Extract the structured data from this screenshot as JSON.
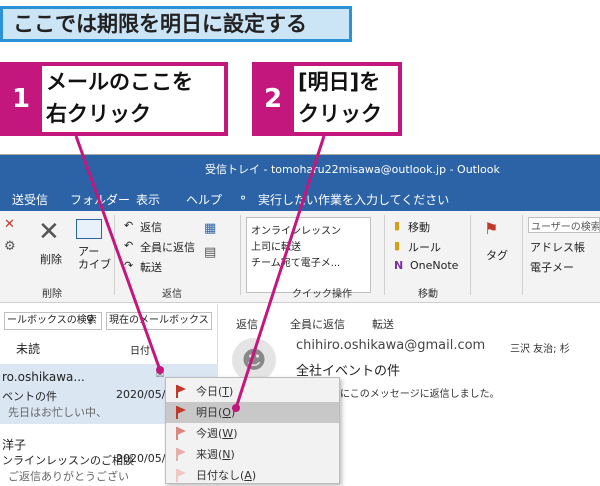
{
  "headline": "ここでは期限を明日に設定する",
  "steps": [
    {
      "num": "1",
      "line1": "メールのここを",
      "line2": "右クリック"
    },
    {
      "num": "2",
      "line1": "[明日]を",
      "line2": "クリック"
    }
  ],
  "colors": {
    "accent": "#c4177d",
    "headline_bg": "#cce5f6",
    "headline_border": "#2a93d8",
    "titlebar": "#2b63a6",
    "flag": "#c0392b"
  },
  "window": {
    "title": "受信トレイ - tomoharu22misawa@outlook.jp  -  Outlook",
    "menu": [
      "送受信",
      "フォルダー",
      "表示",
      "ヘルプ"
    ],
    "tell_me": "実行したい作業を入力してください",
    "tell_me_icon": "lightbulb-icon"
  },
  "ribbon": {
    "delete": {
      "label": "削除",
      "archive": "アー\nカイブ",
      "group": "削除"
    },
    "respond": {
      "reply": "返信",
      "reply_all": "全員に返信",
      "forward": "転送",
      "group": "返信"
    },
    "quick_steps": {
      "items": [
        "オンラインレッスン",
        "上司に転送",
        "チーム宛て電子メ..."
      ],
      "group": "クイック操作"
    },
    "move": {
      "move": "移動",
      "rules": "ルール",
      "onenote": "OneNote",
      "group": "移動"
    },
    "tags": {
      "label": "タグ"
    },
    "find": {
      "search_people": "ユーザーの検索",
      "address_book": "アドレス帳",
      "filter_email": "電子メー"
    }
  },
  "mail_list": {
    "search_placeholder": "ールボックスの検索",
    "scope": "現在のメールボックス",
    "tab_unread": "未読",
    "sort": "日付",
    "messages": [
      {
        "sender": "ro.oshikawa...",
        "subject": "ベントの件",
        "preview": "先日はお忙しい中、",
        "date": "2020/05/"
      },
      {
        "sender": "洋子",
        "subject": "ンラインレッスンのご相談",
        "preview": "ご返信ありがとうござい",
        "date": "2020/05/"
      }
    ]
  },
  "reading_pane": {
    "reply": "返信",
    "reply_all": "全員に返信",
    "forward": "転送",
    "from": "chihiro.oshikawa@gmail.com",
    "to": "三沢 友治; 杉",
    "subject": "全社イベントの件",
    "info": "にこのメッセージに返信しました。"
  },
  "context_menu": [
    {
      "label": "今日(",
      "key": "T",
      "close": ")"
    },
    {
      "label": "明日(",
      "key": "O",
      "close": ")"
    },
    {
      "label": "今週(",
      "key": "W",
      "close": ")"
    },
    {
      "label": "来週(",
      "key": "N",
      "close": ")"
    },
    {
      "label": "日付なし(",
      "key": "A",
      "close": ")"
    }
  ]
}
